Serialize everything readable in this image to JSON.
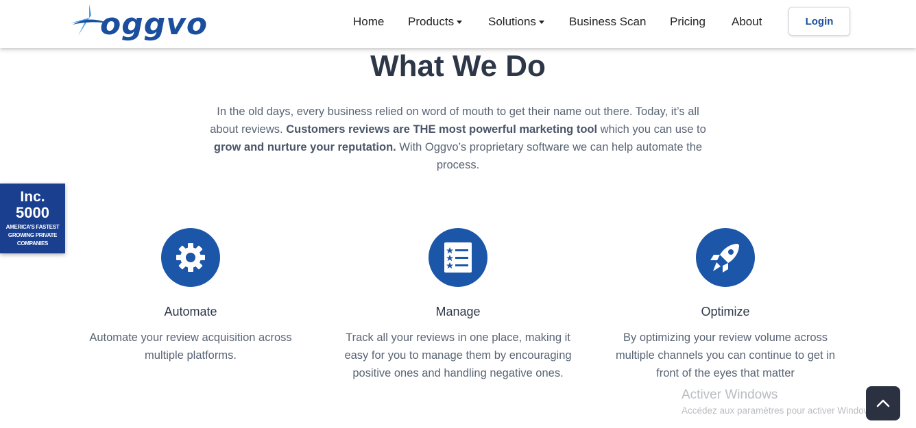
{
  "brand": {
    "name": "oggvo",
    "color": "#1b4f9e"
  },
  "nav": {
    "items": [
      {
        "label": "Home"
      },
      {
        "label": "Products",
        "dropdown": true
      },
      {
        "label": "Solutions",
        "dropdown": true
      },
      {
        "label": "Business Scan"
      },
      {
        "label": "Pricing"
      },
      {
        "label": "About"
      }
    ],
    "login_label": "Login"
  },
  "main": {
    "title": "What We Do",
    "intro": {
      "part1": "In the old days, every business relied on word of mouth to get their name out there. Today, it’s all about reviews. ",
      "bold1": "Customers reviews are THE most powerful marketing tool",
      "part2": " which you can use to ",
      "bold2": "grow and nurture your reputation.",
      "part3": " With Oggvo’s proprietary software we can help automate the process."
    },
    "features": [
      {
        "icon": "gear-icon",
        "title": "Automate",
        "description": "Automate your review acquisition across multiple platforms."
      },
      {
        "icon": "list-stars-icon",
        "title": "Manage",
        "description": "Track all your reviews in one place, making it easy for you to manage them by encouraging positive ones and handling negative ones."
      },
      {
        "icon": "rocket-icon",
        "title": "Optimize",
        "description": "By optimizing your review volume across multiple channels you can continue to get in front of the eyes that matter"
      }
    ]
  },
  "badge": {
    "line1": "Inc.",
    "line2": "5000",
    "line3": "AMERICA'S FASTEST GROWING PRIVATE COMPANIES"
  },
  "watermark": {
    "title": "Activer Windows",
    "subtitle": "Accédez aux paramètres pour activer Windows."
  },
  "colors": {
    "accent": "#1b56a8",
    "badge": "#1a3f8f",
    "text": "#596474"
  }
}
